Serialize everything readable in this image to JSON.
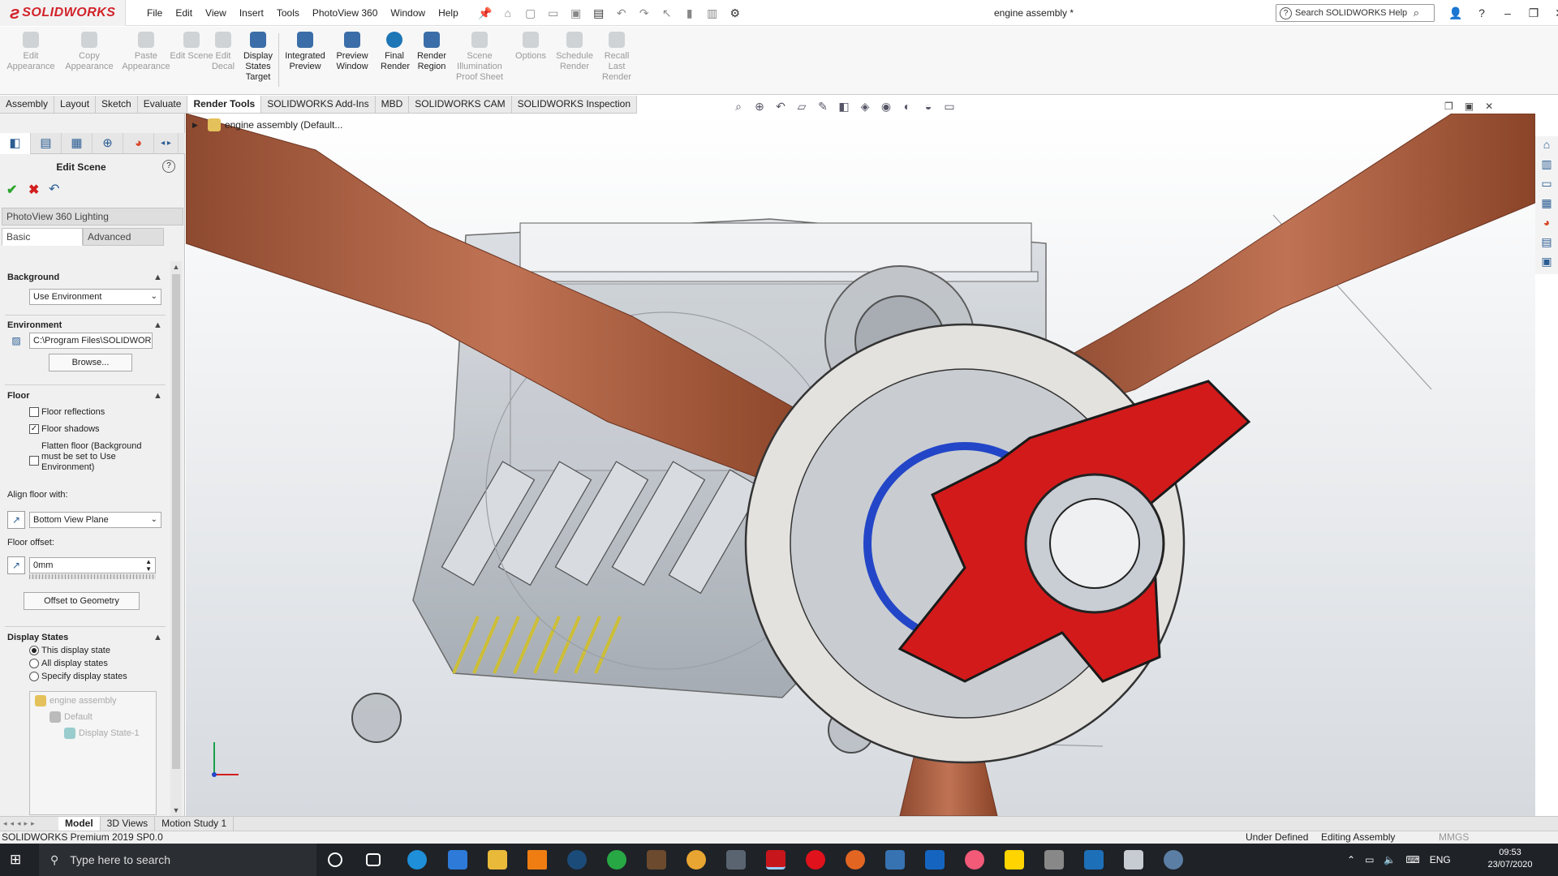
{
  "app": {
    "logo": "SOLIDWORKS",
    "doc_title": "engine assembly *"
  },
  "menu": [
    "File",
    "Edit",
    "View",
    "Insert",
    "Tools",
    "PhotoView 360",
    "Window",
    "Help"
  ],
  "search": {
    "placeholder": "Search SOLIDWORKS Help"
  },
  "ribbon": [
    {
      "label": "Edit Appearance",
      "enabled": false
    },
    {
      "label": "Copy Appearance",
      "enabled": false
    },
    {
      "label": "Paste Appearance",
      "enabled": false
    },
    {
      "label": "Edit Scene",
      "enabled": false
    },
    {
      "label": "Edit Decal",
      "enabled": false
    },
    {
      "label": "Display States Target",
      "enabled": true
    },
    {
      "label": "Integrated Preview",
      "enabled": true
    },
    {
      "label": "Preview Window",
      "enabled": true
    },
    {
      "label": "Final Render",
      "enabled": true
    },
    {
      "label": "Render Region",
      "enabled": true
    },
    {
      "label": "Scene Illumination Proof Sheet",
      "enabled": false
    },
    {
      "label": "Options",
      "enabled": false
    },
    {
      "label": "Schedule Render",
      "enabled": false
    },
    {
      "label": "Recall Last Render",
      "enabled": false
    }
  ],
  "cmd_tabs": [
    "Assembly",
    "Layout",
    "Sketch",
    "Evaluate",
    "Render Tools",
    "SOLIDWORKS Add-Ins",
    "MBD",
    "SOLIDWORKS CAM",
    "SOLIDWORKS Inspection"
  ],
  "active_cmd_tab": "Render Tools",
  "panel": {
    "title": "Edit Scene",
    "group": "PhotoView 360 Lighting",
    "subtabs": [
      "Basic",
      "Advanced"
    ],
    "background": {
      "header": "Background",
      "value": "Use Environment"
    },
    "environment": {
      "header": "Environment",
      "path": "C:\\Program Files\\SOLIDWOR",
      "browse": "Browse..."
    },
    "floor": {
      "header": "Floor",
      "reflections": {
        "label": "Floor reflections",
        "checked": false
      },
      "shadows": {
        "label": "Floor shadows",
        "checked": true
      },
      "flatten": {
        "label": "Flatten floor (Background must be set to Use Environment)",
        "checked": false
      },
      "align_label": "Align floor with:",
      "align_value": "Bottom View Plane",
      "offset_label": "Floor offset:",
      "offset_value": "0mm",
      "offset_button": "Offset to Geometry"
    },
    "display_states": {
      "header": "Display States",
      "options": [
        "This display state",
        "All display states",
        "Specify display states"
      ],
      "selected": 0,
      "tree": [
        "engine assembly",
        "Default",
        "Display State-1"
      ]
    }
  },
  "feature_tree": {
    "root": "engine assembly  (Default..."
  },
  "bottom_tabs": [
    "Model",
    "3D Views",
    "Motion Study 1"
  ],
  "status": {
    "product": "SOLIDWORKS Premium 2019 SP0.0",
    "state": "Under Defined",
    "mode": "Editing Assembly",
    "units": "MMGS"
  },
  "taskbar": {
    "search": "Type here to search",
    "lang": "ENG",
    "time": "09:53",
    "date": "23/07/2020"
  },
  "colors": {
    "brand": "#d2232a",
    "hub": "#d31a1a",
    "prop": "#a85a3a"
  }
}
